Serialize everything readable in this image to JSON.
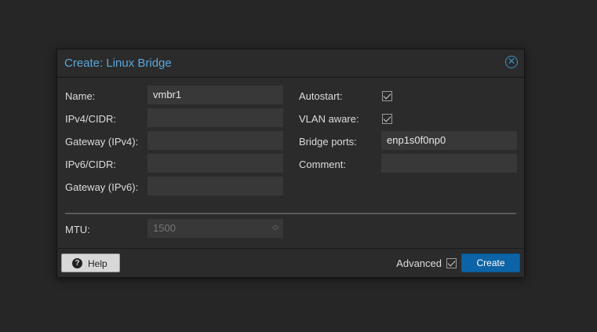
{
  "dialog": {
    "title": "Create: Linux Bridge",
    "close_icon": "close-circle-icon"
  },
  "left": {
    "name": {
      "label": "Name:",
      "value": "vmbr1"
    },
    "ipv4": {
      "label": "IPv4/CIDR:",
      "value": ""
    },
    "gw4": {
      "label": "Gateway (IPv4):",
      "value": ""
    },
    "ipv6": {
      "label": "IPv6/CIDR:",
      "value": ""
    },
    "gw6": {
      "label": "Gateway (IPv6):",
      "value": ""
    }
  },
  "right": {
    "autostart": {
      "label": "Autostart:",
      "checked": true
    },
    "vlan": {
      "label": "VLAN aware:",
      "checked": true
    },
    "ports": {
      "label": "Bridge ports:",
      "value": "enp1s0f0np0"
    },
    "comment": {
      "label": "Comment:",
      "value": ""
    }
  },
  "mtu": {
    "label": "MTU:",
    "placeholder": "1500"
  },
  "footer": {
    "help_label": "Help",
    "help_icon": "question-circle-icon",
    "advanced_label": "Advanced",
    "advanced_checked": true,
    "create_label": "Create"
  },
  "colors": {
    "title": "#5aa6dc",
    "primary_button": "#0c64a6",
    "background": "#262626",
    "dialog": "#2b2b2b",
    "field": "#383838"
  }
}
